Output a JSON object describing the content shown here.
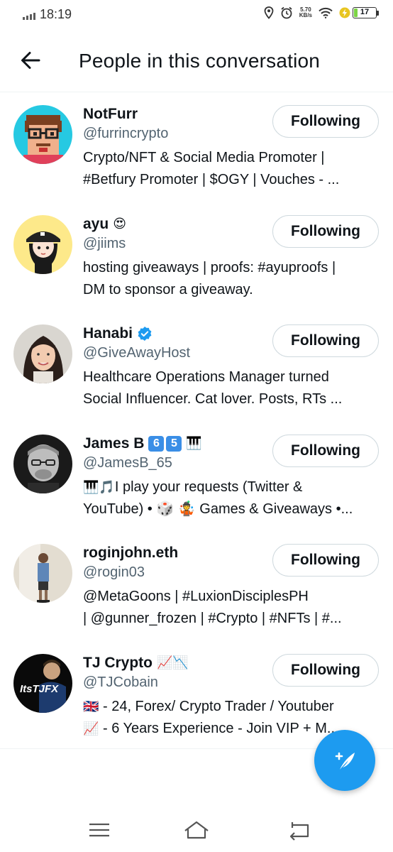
{
  "status_bar": {
    "time": "18:19",
    "net_speed_value": "5.70",
    "net_speed_unit": "KB/s",
    "battery_level": "17"
  },
  "header": {
    "title": "People in this conversation"
  },
  "users": [
    {
      "name": "NotFurr",
      "handle": "@furrincrypto",
      "bio_line1": "Crypto/NFT & Social Media Promoter |",
      "bio_line2": "#Betfury Promoter | $OGY | Vouches - ...",
      "button": "Following"
    },
    {
      "name": "ayu",
      "name_emoji": "😍",
      "handle": "@jiims",
      "bio_line1": "hosting giveaways | proofs: #ayuproofs |",
      "bio_line2": "DM to sponsor a giveaway.",
      "button": "Following"
    },
    {
      "name": "Hanabi",
      "handle": "@GiveAwayHost",
      "bio_line1": "Healthcare Operations Manager turned",
      "bio_line2": "Social Influencer. Cat lover. Posts, RTs ...",
      "button": "Following"
    },
    {
      "name": "James B",
      "keycap1": "6",
      "keycap2": "5",
      "name_emoji": "🎹",
      "handle": "@JamesB_65",
      "bio_line1_emoji": "🎹🎵",
      "bio_line1": "I play your requests (Twitter &",
      "bio_line2": "YouTube) • 🎲 🤹 Games & Giveaways •...",
      "button": "Following"
    },
    {
      "name": "roginjohn.eth",
      "handle": "@rogin03",
      "bio_line1": "@MetaGoons | #LuxionDisciplesPH",
      "bio_line2": "| @gunner_frozen | #Crypto | #NFTs | #...",
      "button": "Following"
    },
    {
      "name": "TJ Crypto",
      "name_emoji": "📈📉",
      "handle": "@TJCobain",
      "bio_line1_emoji": "🇬🇧",
      "bio_line1": " - 24, Forex/ Crypto Trader / Youtuber",
      "bio_line2_emoji": "📈",
      "bio_line2": " - 6 Years Experience - Join VIP + M...",
      "avatar_text": "ItsTJFX",
      "button": "Following"
    }
  ],
  "colors": {
    "accent": "#1d9bf0",
    "text": "#0f1419",
    "secondary": "#536471",
    "border": "#cfd9de"
  }
}
